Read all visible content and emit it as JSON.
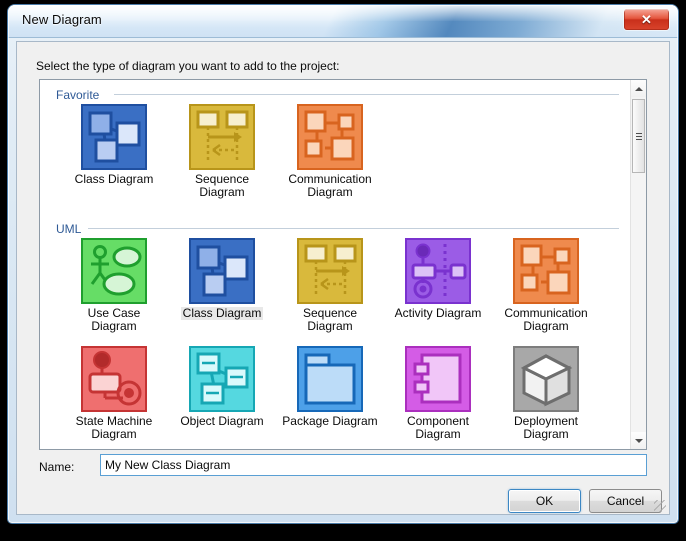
{
  "window": {
    "title": "New Diagram",
    "close_label": "✕"
  },
  "dialog": {
    "instruction": "Select the type of diagram you want to add to the project:",
    "name_label": "Name:",
    "name_value": "My New Class Diagram",
    "name_placeholder": "",
    "ok_label": "OK",
    "cancel_label": "Cancel"
  },
  "sections": [
    {
      "title": "Favorite"
    },
    {
      "title": "UML"
    }
  ],
  "favorite_items": [
    {
      "label": "Class Diagram",
      "icon": "class-diagram-icon",
      "selected": false
    },
    {
      "label": "Sequence Diagram",
      "icon": "sequence-diagram-icon",
      "selected": false
    },
    {
      "label": "Communication Diagram",
      "icon": "communication-diagram-icon",
      "selected": false
    }
  ],
  "uml_items": [
    {
      "label": "Use Case Diagram",
      "icon": "use-case-diagram-icon",
      "selected": false
    },
    {
      "label": "Class Diagram",
      "icon": "class-diagram-icon",
      "selected": true
    },
    {
      "label": "Sequence Diagram",
      "icon": "sequence-diagram-icon",
      "selected": false
    },
    {
      "label": "Activity Diagram",
      "icon": "activity-diagram-icon",
      "selected": false
    },
    {
      "label": "Communication Diagram",
      "icon": "communication-diagram-icon",
      "selected": false
    },
    {
      "label": "State Machine Diagram",
      "icon": "state-machine-diagram-icon",
      "selected": false
    },
    {
      "label": "Object Diagram",
      "icon": "object-diagram-icon",
      "selected": false
    },
    {
      "label": "Package Diagram",
      "icon": "package-diagram-icon",
      "selected": false
    },
    {
      "label": "Component Diagram",
      "icon": "component-diagram-icon",
      "selected": false
    },
    {
      "label": "Deployment Diagram",
      "icon": "deployment-diagram-icon",
      "selected": false
    }
  ],
  "colors": {
    "title_gradient_blue": "#3c78b4",
    "close_red": "#c9301b",
    "section_header_blue": "#2f5a96",
    "selection_highlight": "#e8e8e8",
    "input_focus_border": "#5a9fd4",
    "class_blue": "#3a6fc4",
    "sequence_yellow": "#d9b93c",
    "communication_orange": "#ef8a4d",
    "usecase_green": "#66dd66",
    "activity_purple": "#9b5ce6",
    "state_red": "#ef6f6f",
    "object_cyan": "#55d8e0",
    "package_blue": "#4da0e8",
    "component_magenta": "#d45ce6",
    "deployment_gray": "#a8a8a8"
  }
}
